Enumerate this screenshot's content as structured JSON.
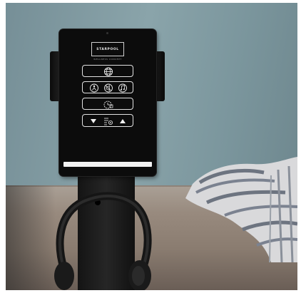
{
  "tablet": {
    "brand": "STARPOOL",
    "tagline": "WELLNESS CONCEPT"
  },
  "icons": {
    "globe": "globe-icon",
    "person": "person-icon",
    "no_sound": "no-sound-icon",
    "music": "music-note-icon",
    "timer": "timer-icon",
    "down": "triangle-down-icon",
    "settings": "settings-list-icon",
    "up": "triangle-up-icon"
  },
  "colors": {
    "wall": "#849ea5",
    "tablet": "#0c0c0c",
    "ui_lines": "#e2e2e2",
    "bed": "#9a8c80"
  }
}
